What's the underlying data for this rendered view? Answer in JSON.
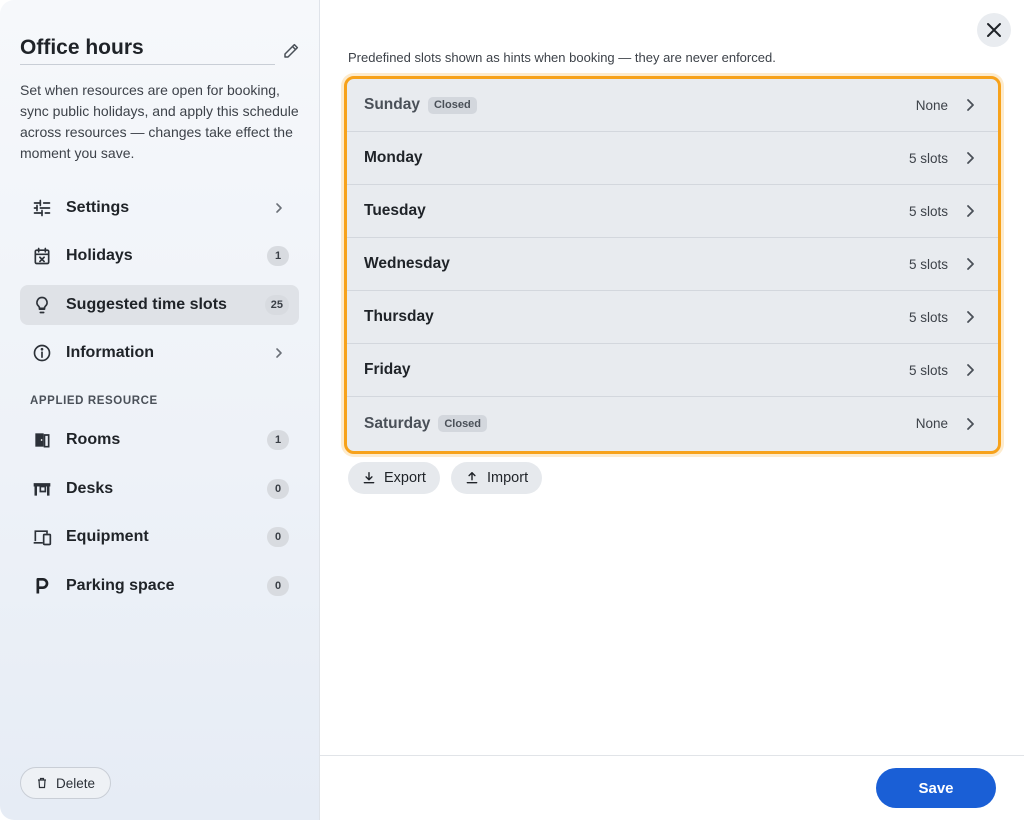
{
  "sidebar": {
    "title": "Office hours",
    "description": "Set when resources are open for booking, sync public holidays, and apply this schedule across resources — changes take effect the moment you save.",
    "nav": [
      {
        "label": "Settings",
        "icon": "sliders-icon"
      },
      {
        "label": "Holidays",
        "icon": "calendar-x-icon",
        "badge": "1"
      },
      {
        "label": "Suggested time slots",
        "icon": "lightbulb-icon",
        "badge": "25",
        "active": true
      },
      {
        "label": "Information",
        "icon": "info-icon"
      }
    ],
    "section_label": "APPLIED RESOURCE",
    "resources": [
      {
        "label": "Rooms",
        "icon": "door-icon",
        "badge": "1"
      },
      {
        "label": "Desks",
        "icon": "desk-icon",
        "badge": "0"
      },
      {
        "label": "Equipment",
        "icon": "devices-icon",
        "badge": "0"
      },
      {
        "label": "Parking space",
        "icon": "parking-icon",
        "badge": "0"
      }
    ],
    "delete_label": "Delete"
  },
  "main": {
    "hint": "Predefined slots shown as hints when booking — they are never enforced.",
    "closed_label": "Closed",
    "days": [
      {
        "name": "Sunday",
        "closed": true,
        "slots": "None"
      },
      {
        "name": "Monday",
        "closed": false,
        "slots": "5 slots"
      },
      {
        "name": "Tuesday",
        "closed": false,
        "slots": "5 slots"
      },
      {
        "name": "Wednesday",
        "closed": false,
        "slots": "5 slots"
      },
      {
        "name": "Thursday",
        "closed": false,
        "slots": "5 slots"
      },
      {
        "name": "Friday",
        "closed": false,
        "slots": "5 slots"
      },
      {
        "name": "Saturday",
        "closed": true,
        "slots": "None"
      }
    ],
    "export_label": "Export",
    "import_label": "Import",
    "save_label": "Save"
  },
  "colors": {
    "accent": "#1a5fd6",
    "highlight": "#f7a21b",
    "row_background": "#e8ebef"
  }
}
